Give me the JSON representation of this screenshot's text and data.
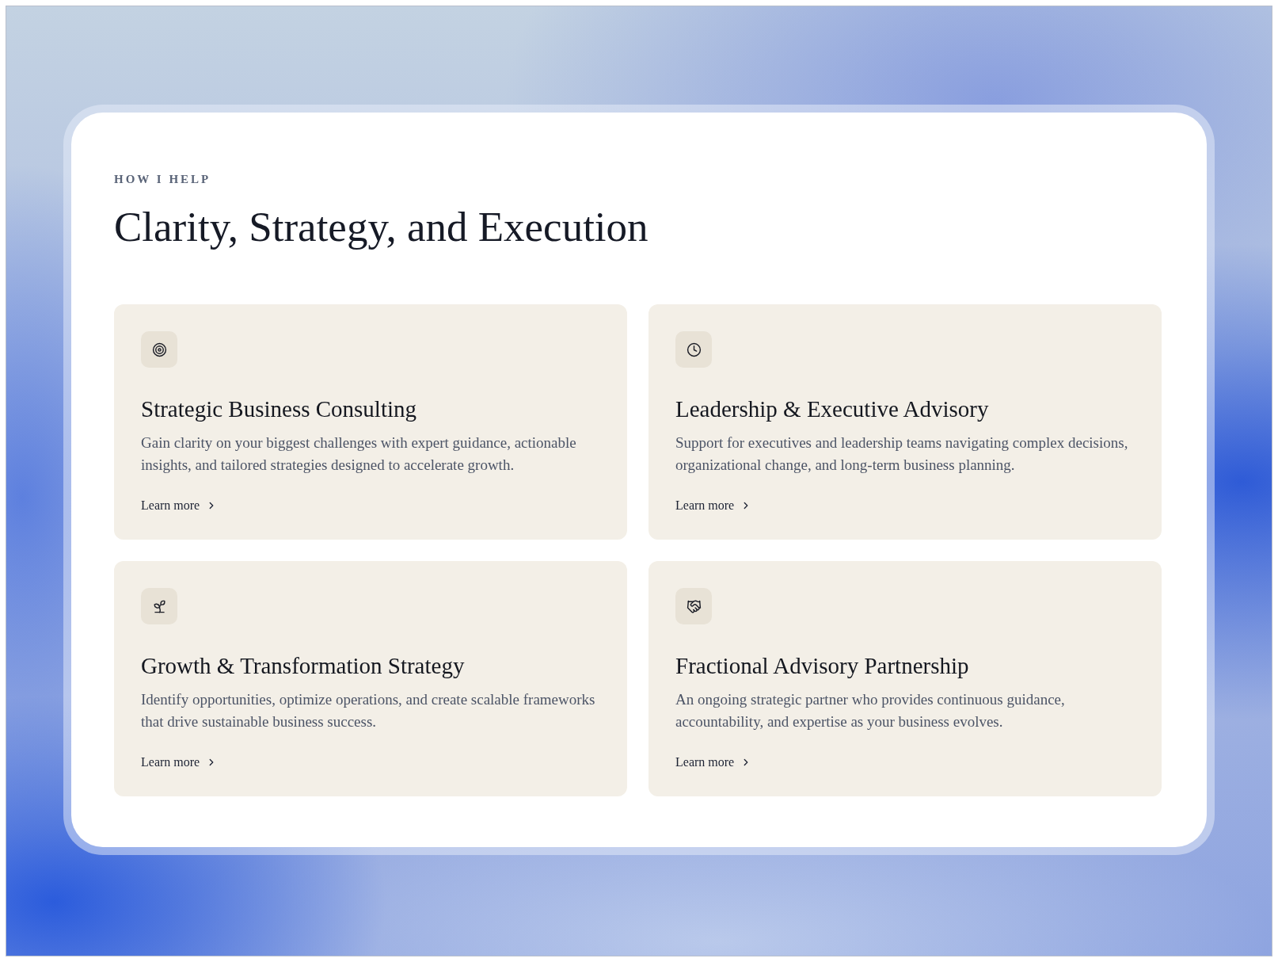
{
  "section": {
    "eyebrow": "HOW I HELP",
    "heading": "Clarity, Strategy, and Execution"
  },
  "services": [
    {
      "kind": "target",
      "title": "Strategic Business Consulting",
      "description": "Gain clarity on your biggest challenges with expert guidance, actionable insights, and tailored strategies designed to accelerate growth.",
      "link": "Learn more"
    },
    {
      "kind": "clock",
      "title": "Leadership & Executive Advisory",
      "description": "Support for executives and leadership teams navigating complex decisions, organizational change, and long-term business planning.",
      "link": "Learn more"
    },
    {
      "kind": "sprout",
      "title": "Growth & Transformation Strategy",
      "description": "Identify opportunities, optimize operations, and create scalable frameworks that drive sustainable business success.",
      "link": "Learn more"
    },
    {
      "kind": "handshake",
      "title": "Fractional Advisory Partnership",
      "description": "An ongoing strategic partner who provides continuous guidance, accountability, and expertise as your business evolves.",
      "link": "Learn more"
    }
  ]
}
